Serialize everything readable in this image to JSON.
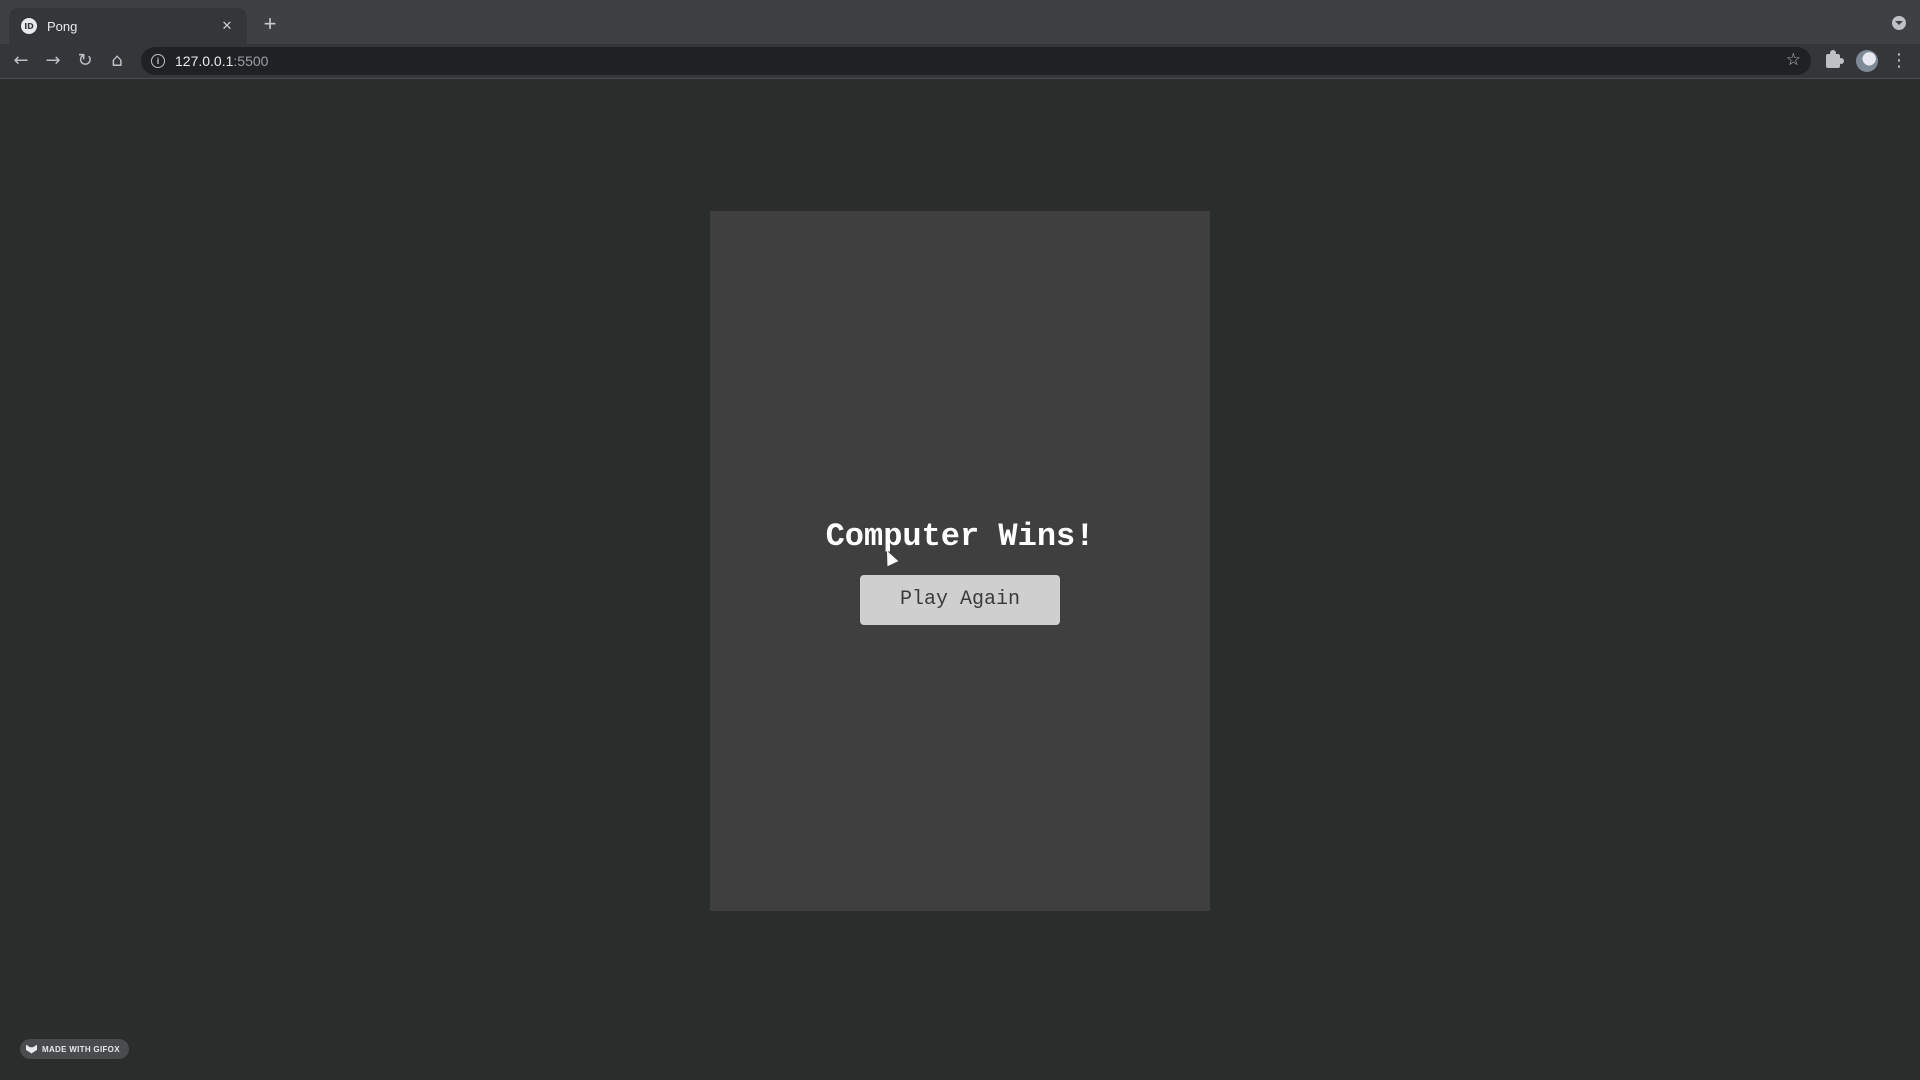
{
  "browser": {
    "tab": {
      "title": "Pong",
      "favicon_label": "ID",
      "close_icon": "close-icon"
    },
    "new_tab_icon": "plus-icon",
    "address_bar": {
      "host": "127.0.0.1",
      "port": ":5500"
    }
  },
  "game": {
    "winner_text": "Computer Wins!",
    "play_again_label": "Play Again"
  },
  "watermark": {
    "label": "MADE WITH GIFOX"
  },
  "colors": {
    "page_background": "#2b2c2c",
    "canvas_background": "#3f3f3f",
    "button_background": "#cfcfcf",
    "text": "#ffffff"
  }
}
